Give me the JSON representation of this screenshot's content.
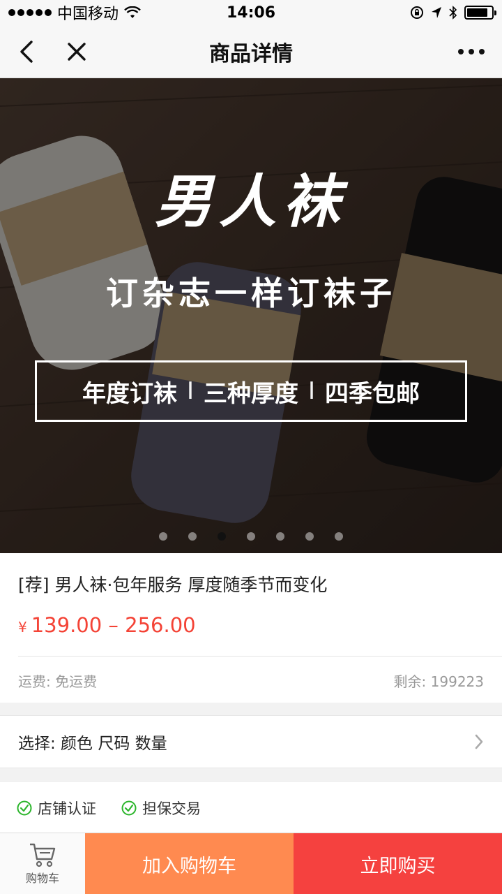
{
  "status_bar": {
    "carrier": "中国移动",
    "time": "14:06",
    "battery_level": 0.85
  },
  "nav": {
    "title": "商品详情",
    "back_icon": "chevron-left-icon",
    "close_icon": "close-icon",
    "more_icon": "more-dots-icon"
  },
  "banner": {
    "brand": "男人袜",
    "subtitle": "订杂志一样订袜子",
    "features": [
      "年度订袜",
      "三种厚度",
      "四季包邮"
    ],
    "separator": "I",
    "slide_count": 7,
    "active_slide": 3
  },
  "product": {
    "title": "[荐] 男人袜·包年服务 厚度随季节而变化",
    "currency": "¥",
    "price_range": "139.00 – 256.00",
    "shipping": "运费: 免运费",
    "stock": "剩余: 199223"
  },
  "select": {
    "label": "选择: 颜色 尺码 数量"
  },
  "badges": [
    {
      "label": "店铺认证",
      "icon": "check-circle-icon"
    },
    {
      "label": "担保交易",
      "icon": "check-circle-icon"
    }
  ],
  "bottom_bar": {
    "cart_label": "购物车",
    "add_to_cart": "加入购物车",
    "buy_now": "立即购买"
  },
  "colors": {
    "price": "#f44336",
    "add_to_cart_bg": "#ff8a50",
    "buy_now_bg": "#f5413f",
    "badge_check": "#2bb52b"
  }
}
